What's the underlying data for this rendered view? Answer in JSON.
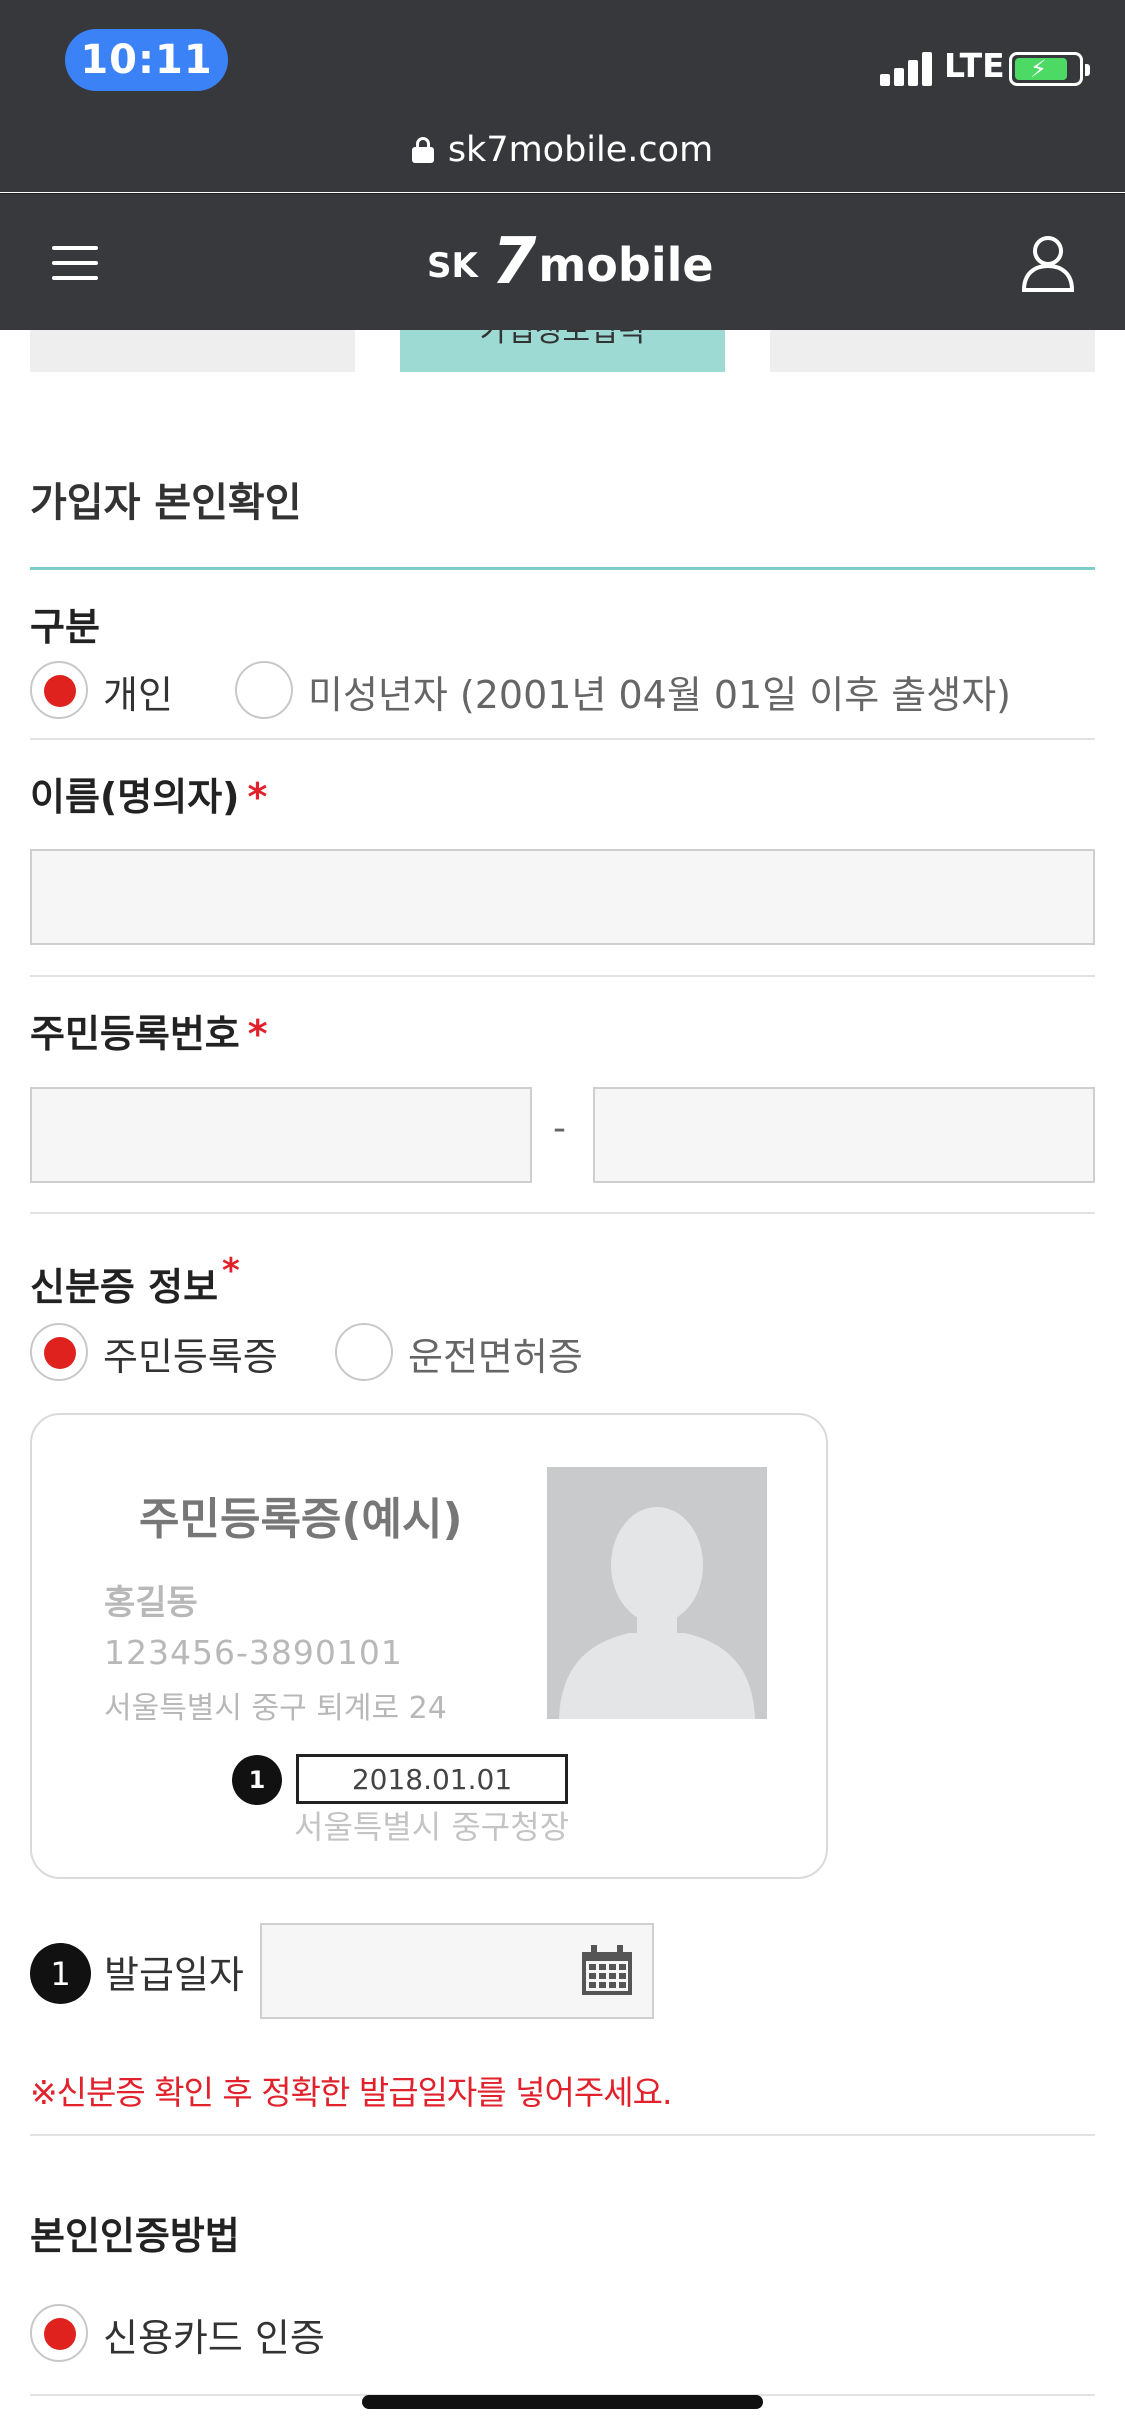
{
  "status_bar": {
    "time": "10:11",
    "network": "LTE",
    "url": "sk7mobile.com"
  },
  "header": {
    "logo_sk": "SK",
    "logo_seven": "7",
    "logo_mobile": "mobile",
    "menu_icon": "hamburger-icon",
    "user_icon": "user-icon"
  },
  "steps": {
    "active_partial_label": "가입정보입력"
  },
  "form": {
    "section_title": "가입자 본인확인",
    "type": {
      "label": "구분",
      "options": [
        "개인",
        "미성년자 (2001년 04월 01일 이후 출생자)"
      ],
      "selected": "개인"
    },
    "name": {
      "label": "이름(명의자)",
      "required_mark": "*",
      "value": ""
    },
    "rrn": {
      "label": "주민등록번호",
      "required_mark": "*",
      "separator": "-",
      "first": "",
      "second": ""
    },
    "id_info": {
      "label": "신분증 정보",
      "required_mark": "*",
      "options": [
        "주민등록증",
        "운전면허증"
      ],
      "selected": "주민등록증"
    },
    "id_example": {
      "title": "주민등록증(예시)",
      "name": "홍길동",
      "number": "123456-3890101",
      "address": "서울특별시 중구 퇴계로 24",
      "marker": "1",
      "issue_date": "2018.01.01",
      "issuer": "서울특별시 중구청장"
    },
    "issue_date": {
      "marker": "1",
      "label": "발급일자",
      "value": "",
      "icon": "calendar-icon"
    },
    "notice": "※신분증 확인 후 정확한 발급일자를 넣어주세요.",
    "auth": {
      "label": "본인인증방법",
      "options": [
        "신용카드 인증"
      ],
      "selected": "신용카드 인증"
    }
  },
  "colors": {
    "status_bar_bg": "#36383c",
    "accent_teal": "#9edad4",
    "radio_selected": "#e0221e",
    "required": "#e1212b",
    "time_pill": "#3b82f6"
  }
}
